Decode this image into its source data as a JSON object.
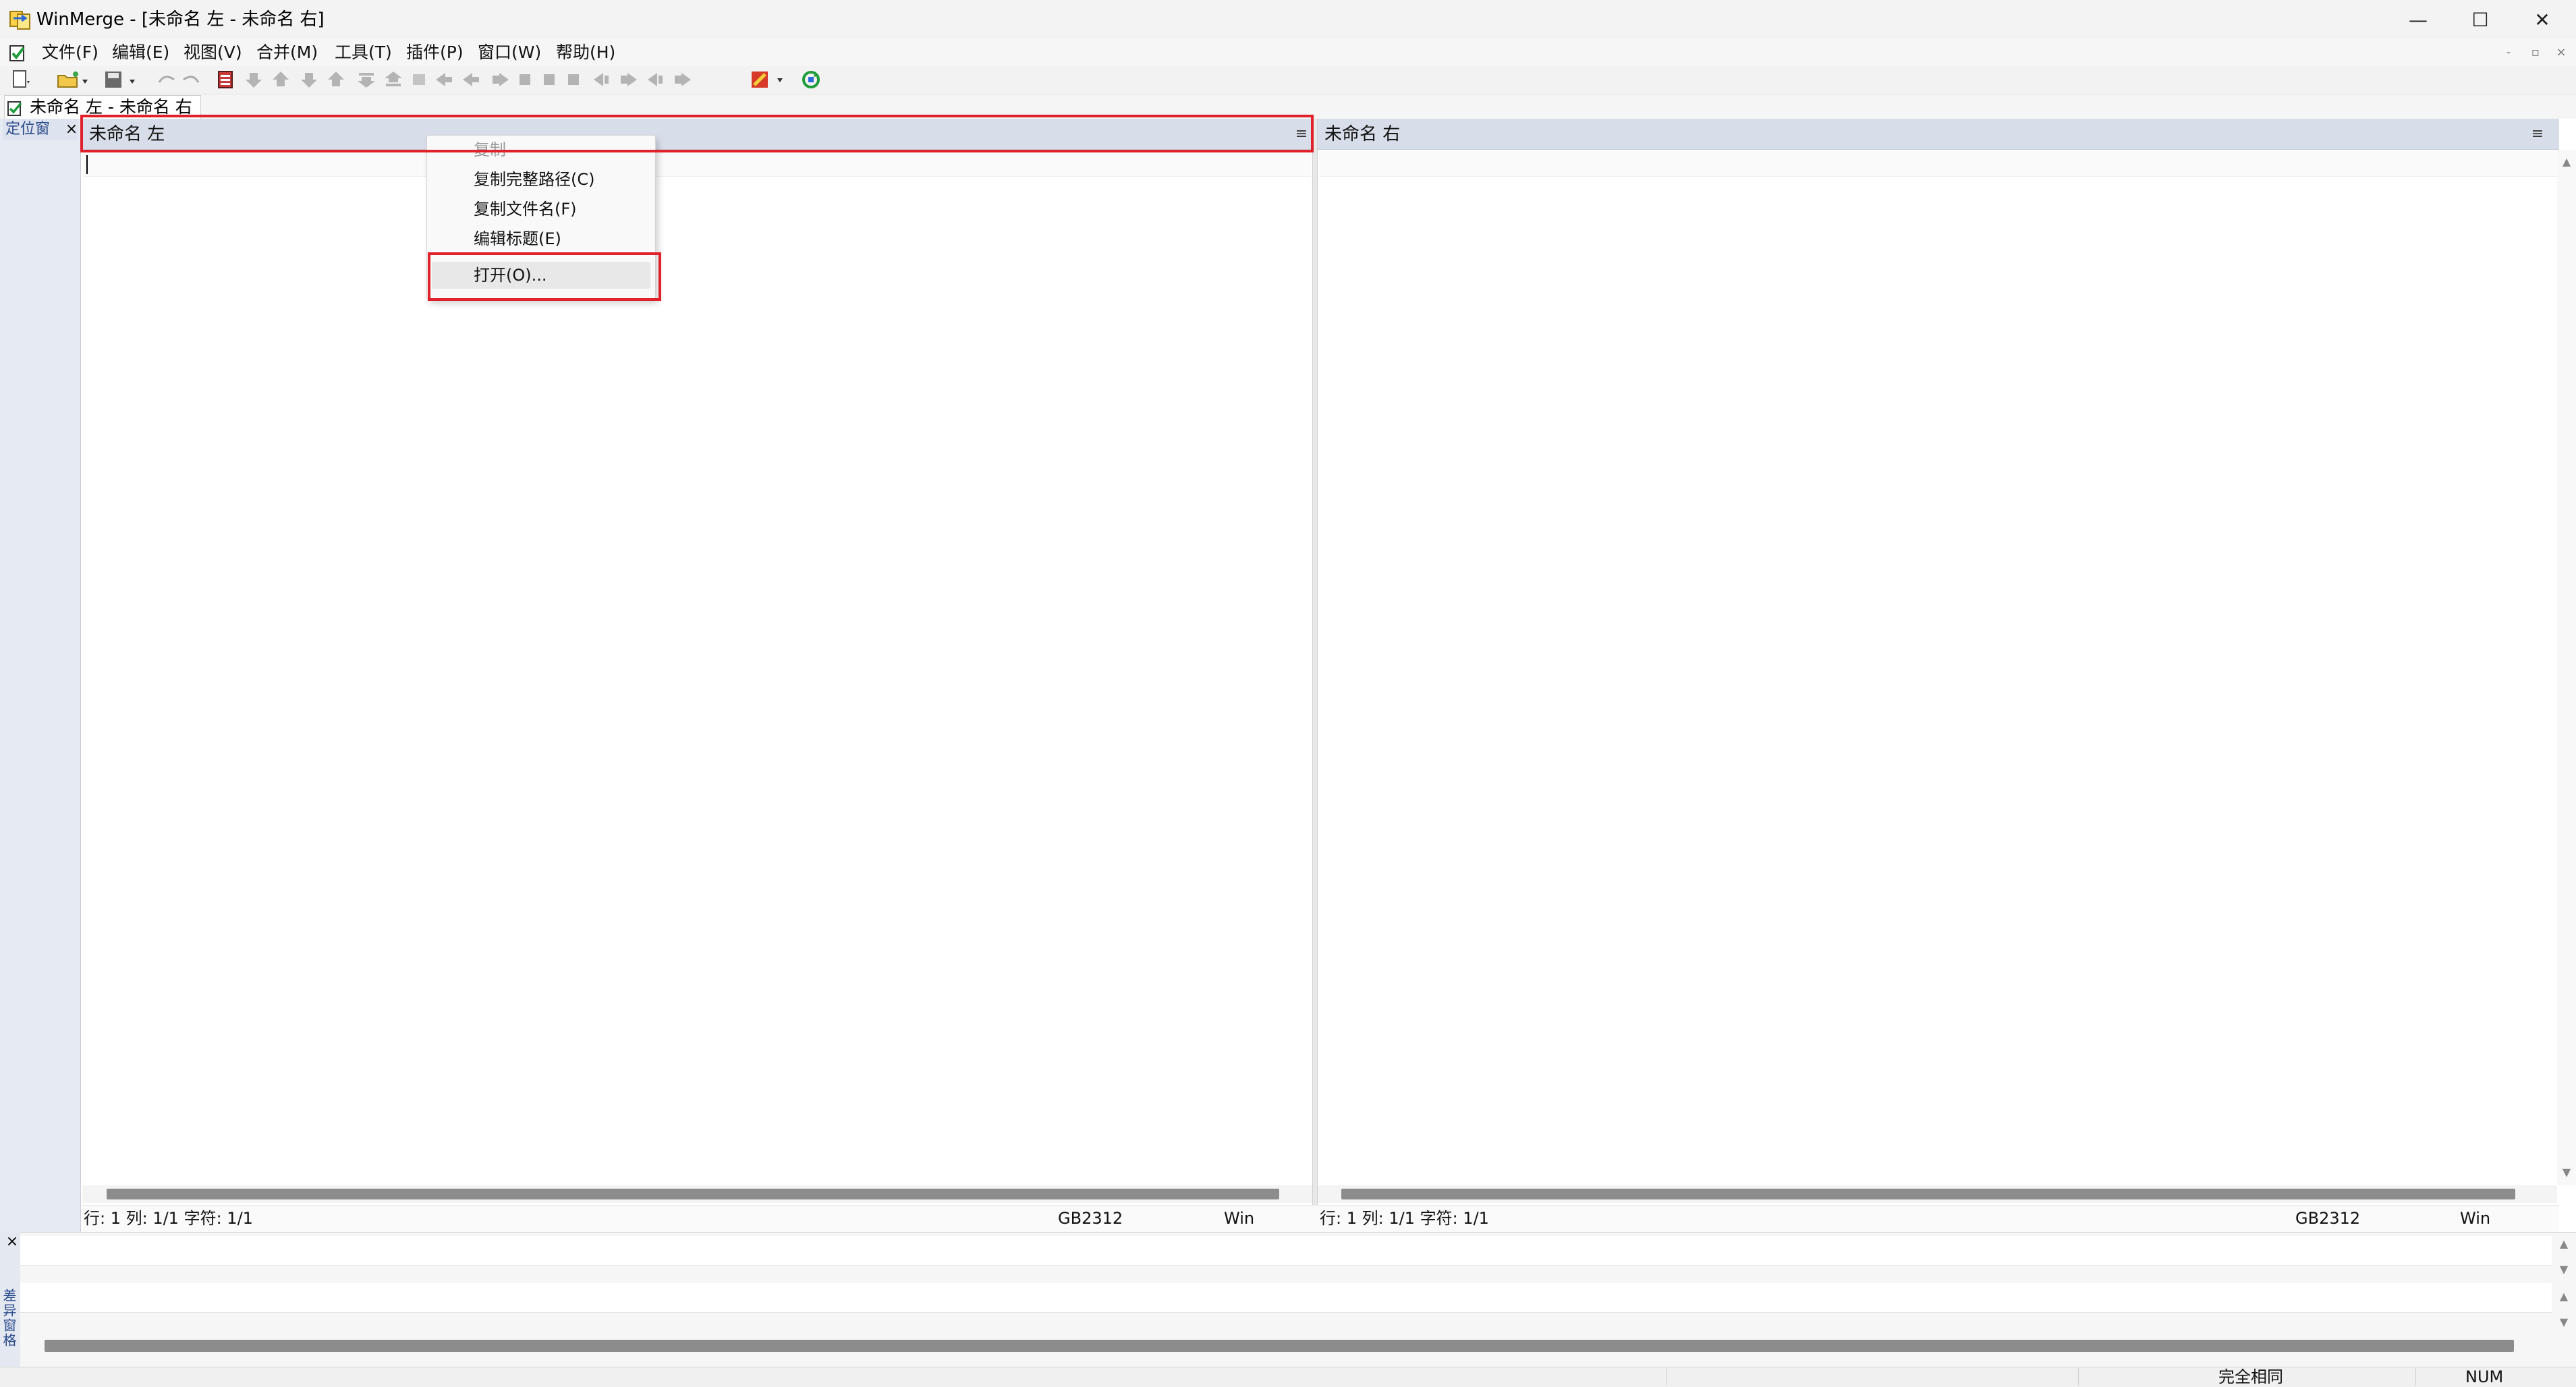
{
  "window": {
    "title": "WinMerge - [未命名 左 - 未命名 右]",
    "controls": {
      "minimize": "—",
      "maximize": "☐",
      "close": "✕"
    }
  },
  "menu": {
    "items": [
      {
        "label": "文件(F)"
      },
      {
        "label": "编辑(E)"
      },
      {
        "label": "视图(V)"
      },
      {
        "label": "合并(M)"
      },
      {
        "label": "工具(T)"
      },
      {
        "label": "插件(P)"
      },
      {
        "label": "窗口(W)"
      },
      {
        "label": "帮助(H)"
      }
    ],
    "mdi_controls": {
      "minimize": "-",
      "restore": "▫",
      "close": "×"
    }
  },
  "tab": {
    "label": "未命名 左 - 未命名 右"
  },
  "location_pane": {
    "label": "定位窗",
    "close": "×"
  },
  "left_pane": {
    "title": "未命名 左",
    "menu_glyph": "≡",
    "status": {
      "position": "行: 1  列: 1/1  字符: 1/1",
      "encoding": "GB2312",
      "eol": "Win"
    }
  },
  "right_pane": {
    "title": "未命名 右",
    "menu_glyph": "≡",
    "status": {
      "position": "行: 1  列: 1/1  字符: 1/1",
      "encoding": "GB2312",
      "eol": "Win"
    }
  },
  "context_menu": {
    "items": [
      {
        "label": "复制",
        "enabled": false
      },
      {
        "label": "复制完整路径(C)",
        "enabled": true
      },
      {
        "label": "复制文件名(F)",
        "enabled": true
      },
      {
        "label": "编辑标题(E)",
        "enabled": true
      },
      {
        "label": "打开(O)...",
        "enabled": true,
        "highlighted": true
      }
    ]
  },
  "diff_pane": {
    "label": "差异窗格",
    "close": "×"
  },
  "statusbar": {
    "message": "完全相同",
    "num": "NUM"
  },
  "colors": {
    "highlight": "#e0202a",
    "pane_header": "#d8dee9",
    "location_pane": "#e6eaf3"
  }
}
